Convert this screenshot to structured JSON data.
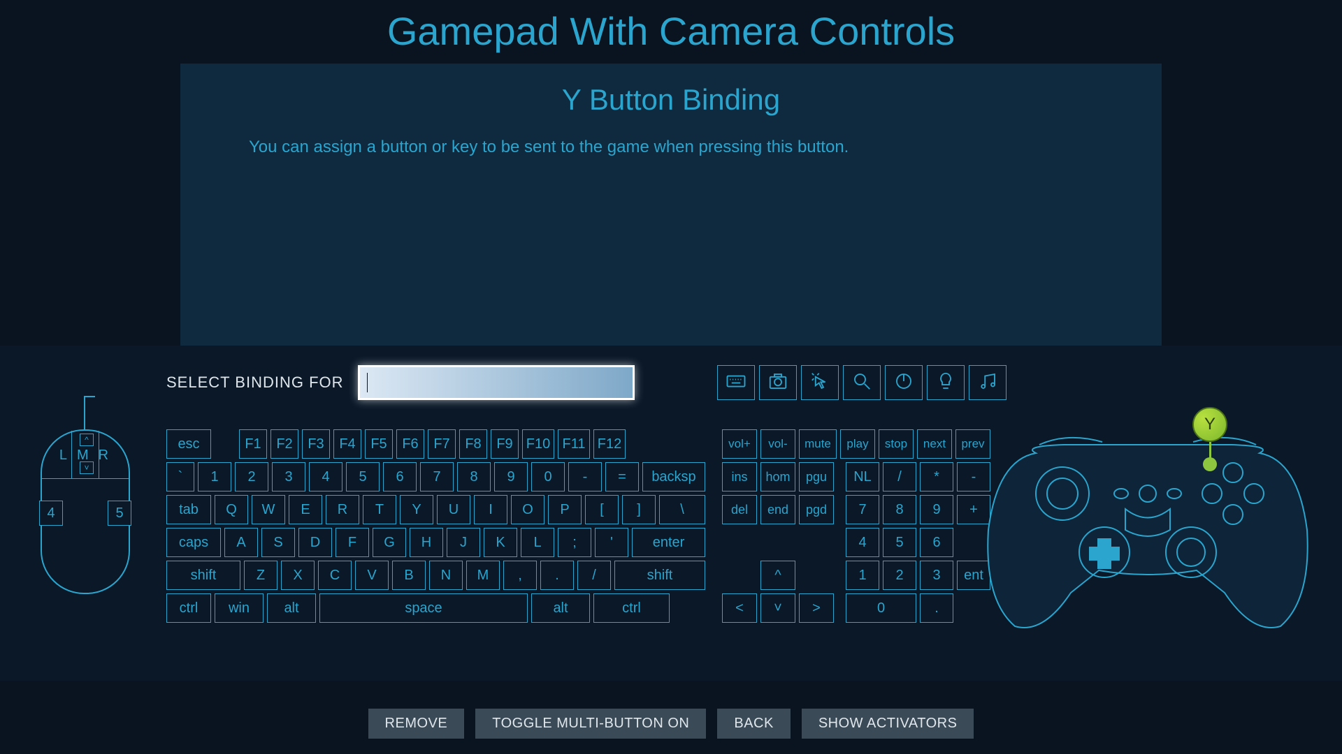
{
  "header": {
    "title": "Gamepad With Camera Controls"
  },
  "panel": {
    "subtitle": "Y Button Binding",
    "description": "You can assign a button or key to be sent to the game when pressing this button."
  },
  "binding": {
    "label": "SELECT BINDING FOR",
    "value": ""
  },
  "tabs": {
    "keyboard": "keyboard",
    "camera": "camera",
    "mouse_click": "mouse-click",
    "magnify": "magnify",
    "power": "power",
    "light": "light",
    "music": "music"
  },
  "mouse": {
    "l": "L",
    "m": "M",
    "r": "R",
    "b4": "4",
    "b5": "5",
    "up": "^",
    "dn": "˅"
  },
  "keys": {
    "r0": [
      "esc",
      "F1",
      "F2",
      "F3",
      "F4",
      "F5",
      "F6",
      "F7",
      "F8",
      "F9",
      "F10",
      "F11",
      "F12"
    ],
    "r1": [
      "`",
      "1",
      "2",
      "3",
      "4",
      "5",
      "6",
      "7",
      "8",
      "9",
      "0",
      "-",
      "=",
      "backsp"
    ],
    "r2": [
      "tab",
      "Q",
      "W",
      "E",
      "R",
      "T",
      "Y",
      "U",
      "I",
      "O",
      "P",
      "[",
      "]",
      "\\"
    ],
    "r3": [
      "caps",
      "A",
      "S",
      "D",
      "F",
      "G",
      "H",
      "J",
      "K",
      "L",
      ";",
      "'",
      "enter"
    ],
    "r4": [
      "shift",
      "Z",
      "X",
      "C",
      "V",
      "B",
      "N",
      "M",
      ",",
      ".",
      "/",
      "shift"
    ],
    "r5": [
      "ctrl",
      "win",
      "alt",
      "space",
      "alt",
      "ctrl"
    ]
  },
  "media": {
    "r0": [
      "vol+",
      "vol-",
      "mute",
      "play",
      "stop",
      "next",
      "prev"
    ],
    "r1": [
      "ins",
      "hom",
      "pgu"
    ],
    "r2": [
      "del",
      "end",
      "pgd"
    ],
    "arrow_up": "^",
    "arrow_l": "<",
    "arrow_d": "˅",
    "arrow_r": ">"
  },
  "numpad": {
    "r0": [
      "NL",
      "/",
      "*",
      "-"
    ],
    "r1": [
      "7",
      "8",
      "9",
      "+"
    ],
    "r2": [
      "4",
      "5",
      "6"
    ],
    "r3": [
      "1",
      "2",
      "3",
      "ent"
    ],
    "r4": [
      "0",
      "."
    ]
  },
  "controller": {
    "y_label": "Y"
  },
  "footer": {
    "remove": "REMOVE",
    "toggle": "TOGGLE MULTI-BUTTON ON",
    "back": "BACK",
    "activators": "SHOW ACTIVATORS"
  }
}
